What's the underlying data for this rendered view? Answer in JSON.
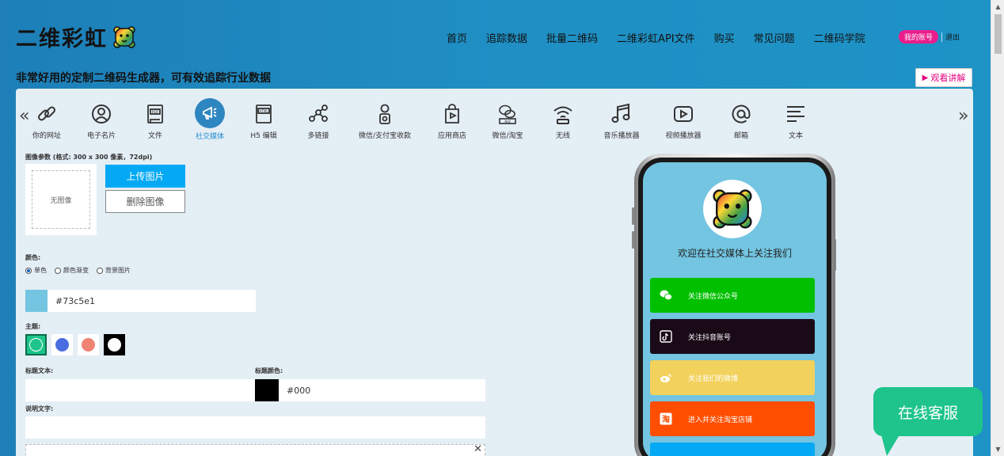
{
  "header": {
    "logo_text": "二维彩虹",
    "nav": [
      "首页",
      "追踪数据",
      "批量二维码",
      "二维彩虹API文件",
      "购买",
      "常见问题",
      "二维码学院"
    ],
    "account_label": "我的账号",
    "logout_label": "退出",
    "tagline": "非常好用的定制二维码生成器，可有效追踪行业数据",
    "watch_label": "观看讲解"
  },
  "tools": [
    {
      "label": "你的网址",
      "icon": "link-icon"
    },
    {
      "label": "电子名片",
      "icon": "user-card-icon"
    },
    {
      "label": "文件",
      "icon": "pdf-file-icon"
    },
    {
      "label": "社交媒体",
      "icon": "megaphone-icon",
      "active": true
    },
    {
      "label": "H5 编辑",
      "icon": "html-icon"
    },
    {
      "label": "多链接",
      "icon": "multi-link-icon"
    },
    {
      "label": "微信/支付宝收款",
      "icon": "payment-icon"
    },
    {
      "label": "应用商店",
      "icon": "app-store-icon"
    },
    {
      "label": "微信/淘宝",
      "icon": "wechat-taobao-icon"
    },
    {
      "label": "无线",
      "icon": "wifi-icon"
    },
    {
      "label": "音乐播放器",
      "icon": "music-icon"
    },
    {
      "label": "视频播放器",
      "icon": "video-icon"
    },
    {
      "label": "邮箱",
      "icon": "at-icon"
    },
    {
      "label": "文本",
      "icon": "text-icon"
    }
  ],
  "form": {
    "image_params_label": "图像参数 (格式: 300 x 300 像素，72dpi)",
    "no_image": "无图像",
    "upload_label": "上传图片",
    "delete_label": "删除图像",
    "color_label": "颜色:",
    "color_options": [
      "单色",
      "颜色渐变",
      "背景图片"
    ],
    "color_value": "#73c5e1",
    "theme_label": "主题:",
    "title_text_label": "标题文本:",
    "title_color_label": "标题颜色:",
    "title_color_value": "#000",
    "desc_label": "说明文字:"
  },
  "preview": {
    "welcome": "欢迎在社交媒体上关注我们",
    "buttons": [
      {
        "label": "关注微信公众号",
        "color": "#00c000",
        "icon": "wechat-icon"
      },
      {
        "label": "关注抖音账号",
        "color": "#1a0a18",
        "icon": "tiktok-icon"
      },
      {
        "label": "关注我们的微博",
        "color": "#f2d15c",
        "icon": "weibo-icon"
      },
      {
        "label": "进入并关注淘宝店铺",
        "color": "#ff4e00",
        "icon": "taobao-icon"
      }
    ]
  },
  "chat_label": "在线客服",
  "colors": {
    "accent": "#03a9f4",
    "brand_pink": "#e91e8c",
    "preview_bg": "#73c5e1",
    "chat": "#1ec48b"
  }
}
